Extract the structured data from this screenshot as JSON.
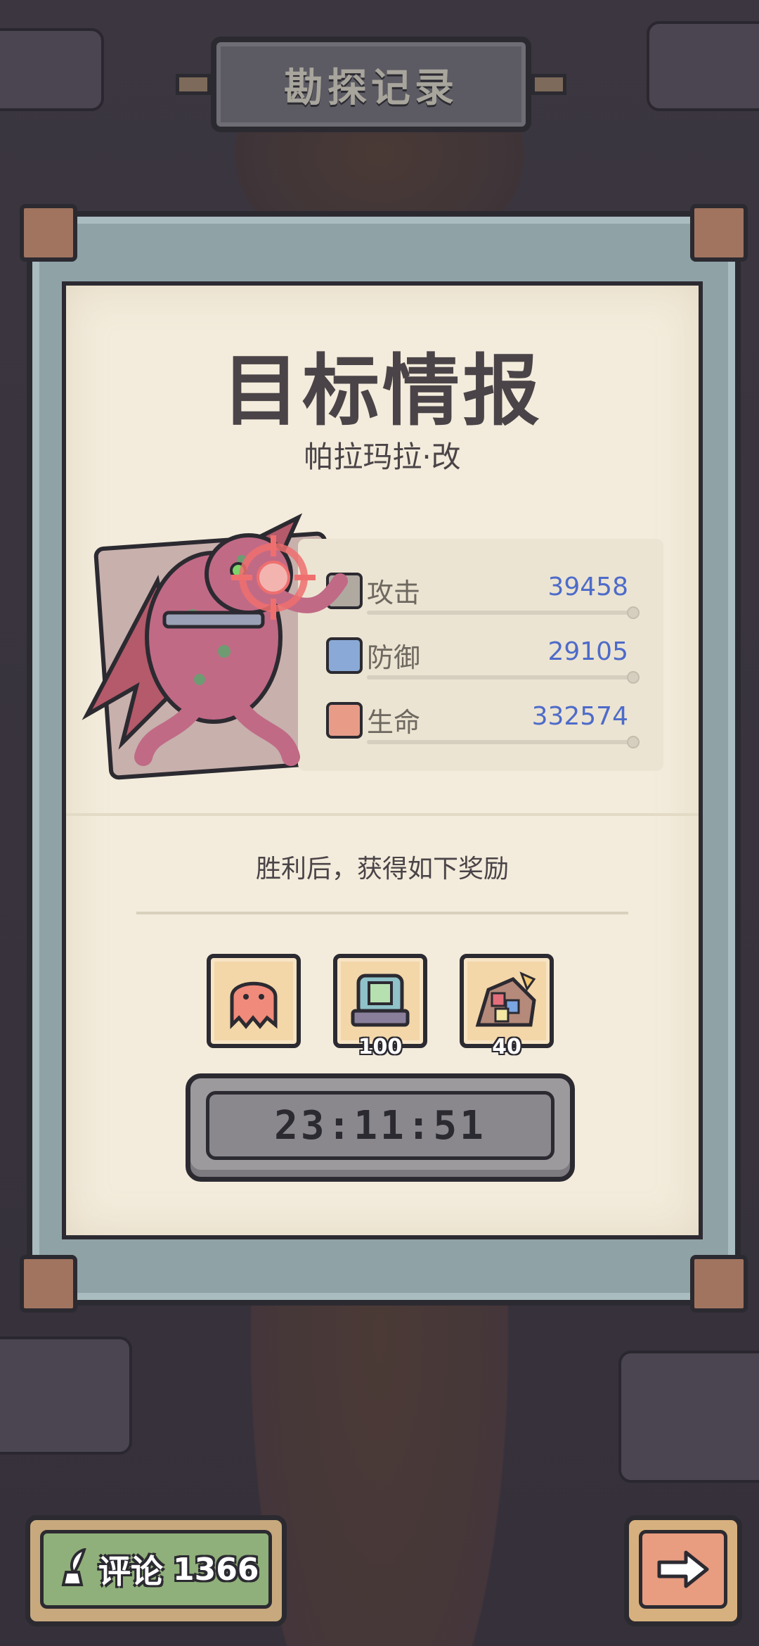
{
  "header": {
    "title": "勘探记录"
  },
  "intel": {
    "title": "目标情报",
    "target_name": "帕拉玛拉·改",
    "monster_icon": "winged-tentacle-monster",
    "target_icon": "crosshair-rose-icon"
  },
  "stats": [
    {
      "label": "攻击",
      "value": "39458",
      "icon": "attack-icon"
    },
    {
      "label": "防御",
      "value": "29105",
      "icon": "shield-icon"
    },
    {
      "label": "生命",
      "value": "332574",
      "icon": "heart-bar-icon"
    }
  ],
  "rewards": {
    "caption": "胜利后，获得如下奖励",
    "items": [
      {
        "icon": "pink-ghost-icon",
        "count": ""
      },
      {
        "icon": "machine-part-icon",
        "count": "100"
      },
      {
        "icon": "gem-pile-icon",
        "count": "40"
      }
    ]
  },
  "timer": {
    "value": "23:11:51"
  },
  "footer": {
    "comment_label": "评论",
    "comment_count": "1366",
    "comment_icon": "quill-ink-icon",
    "next_icon": "arrow-right-icon"
  },
  "colors": {
    "stat_value": "#4d6bc9",
    "paper": "#f3ecdc",
    "frame": "#8fa3a7",
    "comment_button": "#8fb07a",
    "next_button": "#e89c80"
  }
}
